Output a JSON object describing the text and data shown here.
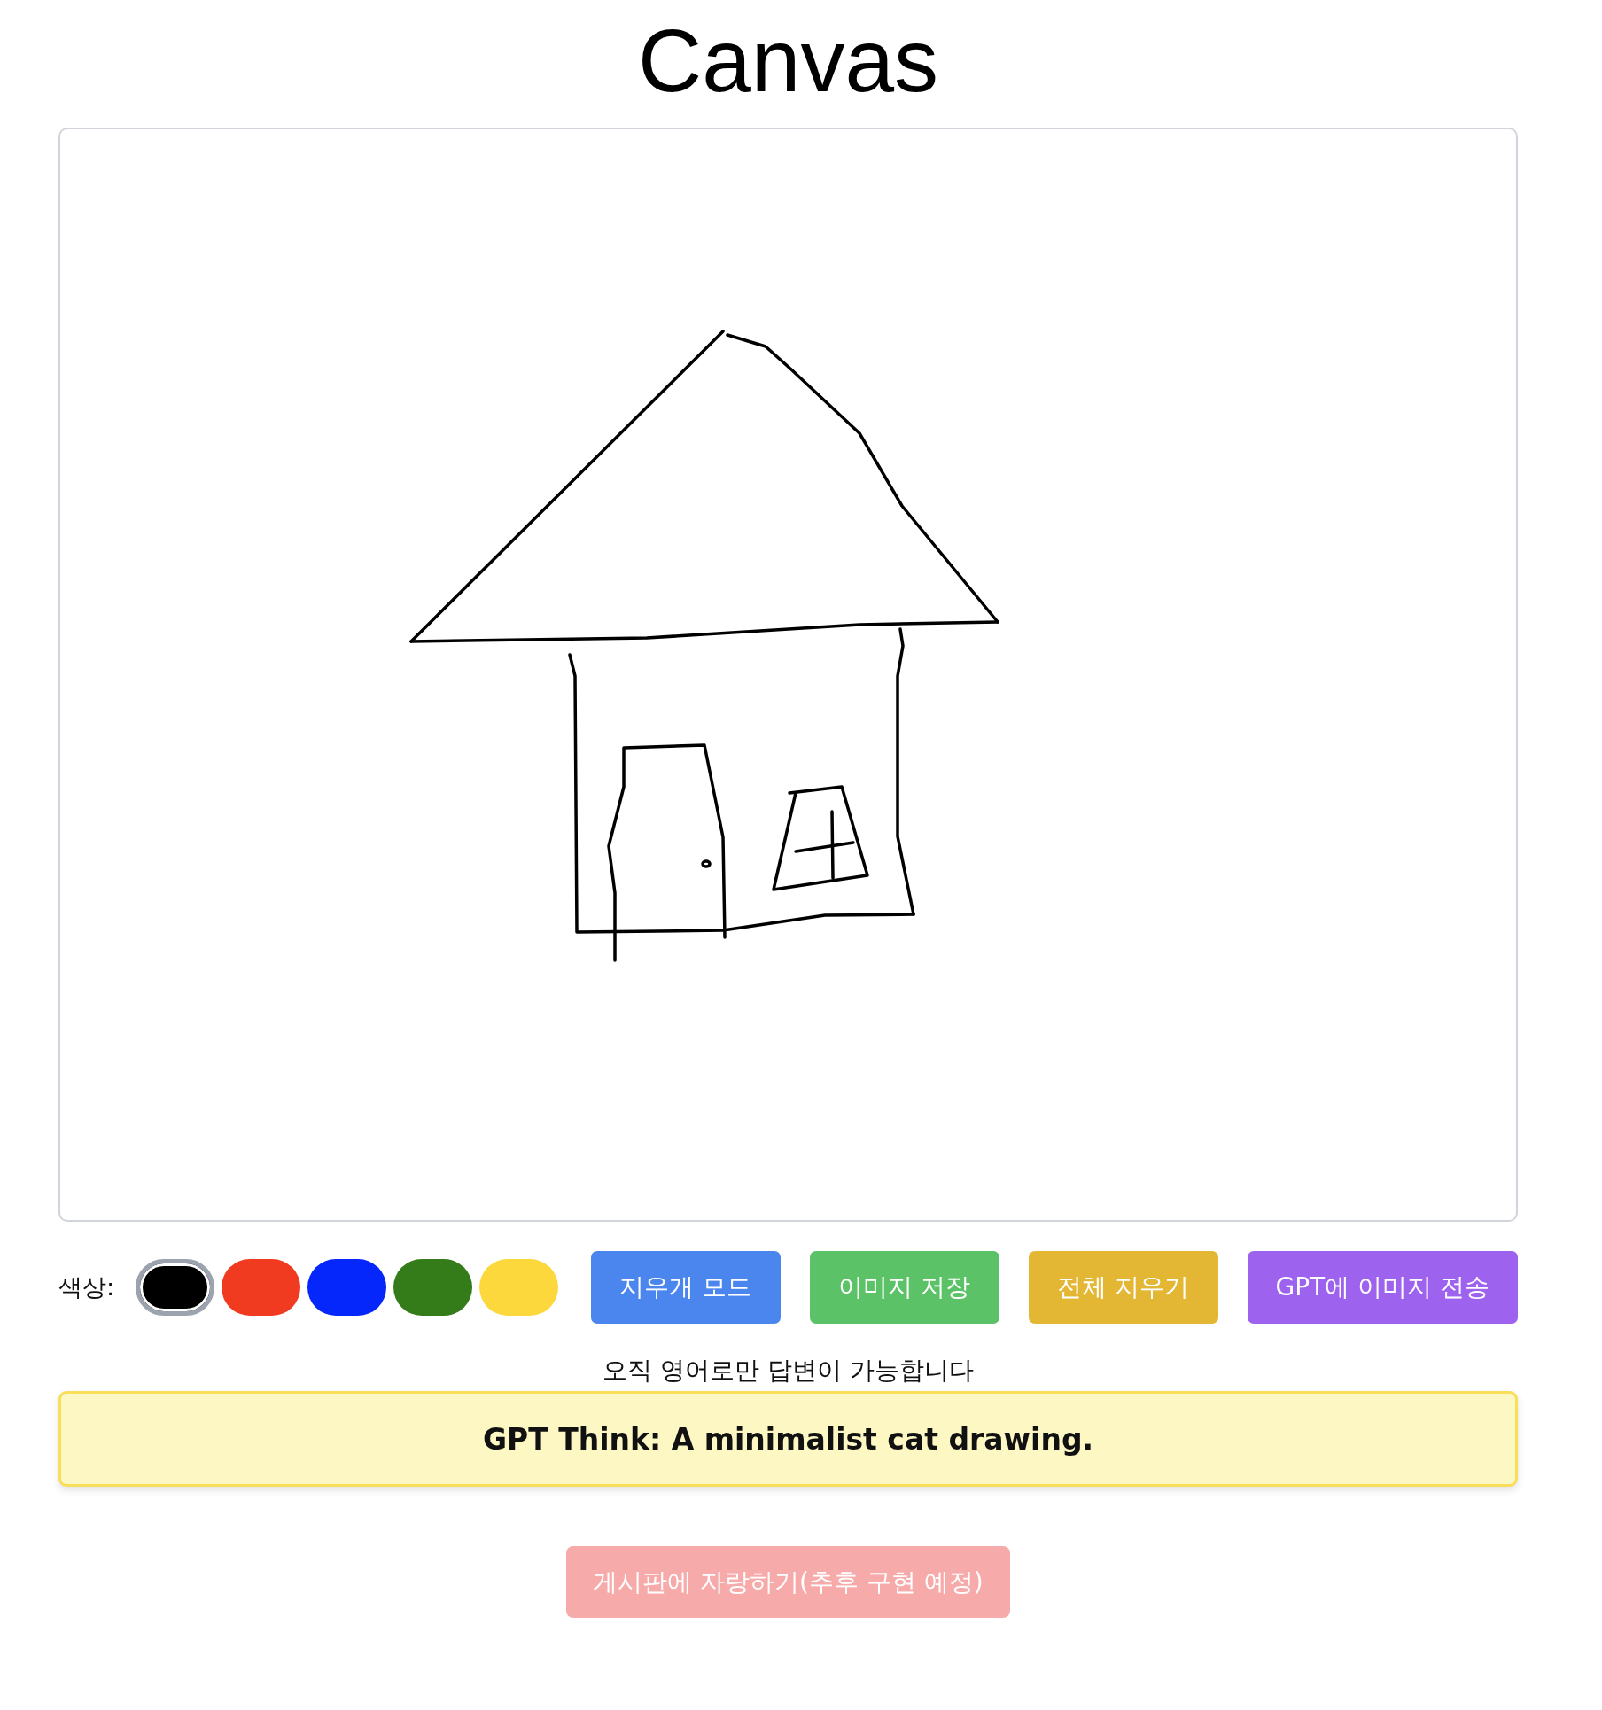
{
  "title": "Canvas",
  "palette": {
    "label": "색상:",
    "colors": [
      {
        "color": "#000000",
        "selected": true
      },
      {
        "color": "#f03b20",
        "selected": false
      },
      {
        "color": "#0527fb",
        "selected": false
      },
      {
        "color": "#347b19",
        "selected": false
      },
      {
        "color": "#fcd83c",
        "selected": false
      }
    ]
  },
  "actions": [
    {
      "label": "지우개 모드",
      "color": "#4a86ee"
    },
    {
      "label": "이미지 저장",
      "color": "#5bc267"
    },
    {
      "label": "전체 지우기",
      "color": "#e3b633"
    },
    {
      "label": "GPT에 이미지 전송",
      "color": "#9d62ee"
    }
  ],
  "notice": "오직 영어로만 답변이 가능합니다",
  "gpt_response": "GPT Think: A minimalist cat drawing.",
  "share_button": {
    "label": "게시판에 자랑하기(추후 구현 예정)",
    "disabled": true
  }
}
